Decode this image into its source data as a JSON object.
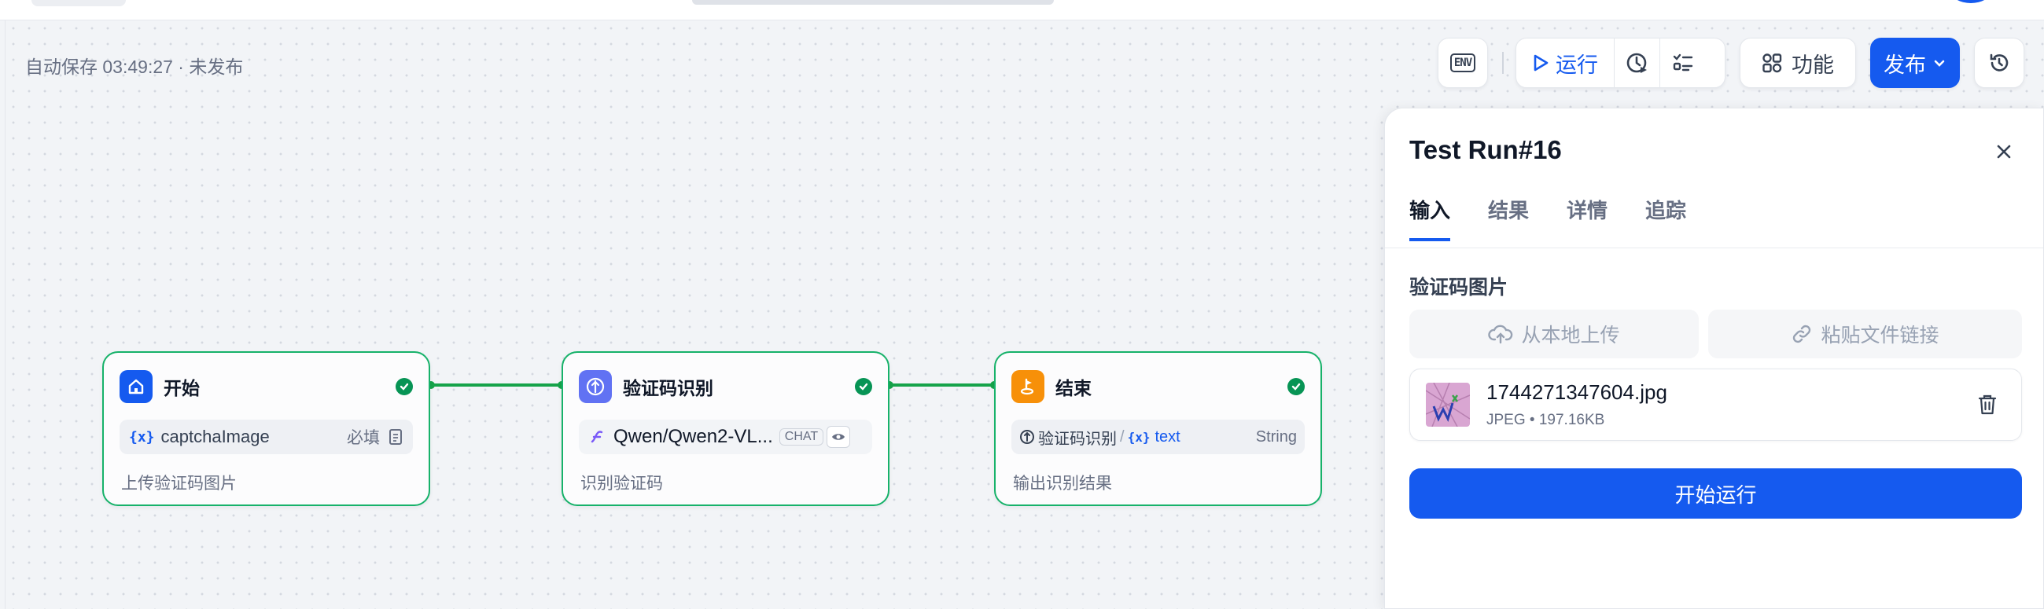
{
  "autosave": {
    "text": "自动保存 03:49:27 · 未发布"
  },
  "toolbar": {
    "env_label": "ENV",
    "run_label": "运行",
    "features_label": "功能",
    "publish_label": "发布",
    "accent": "#155aef"
  },
  "nodes": [
    {
      "title": "开始",
      "icon": "home-icon",
      "icon_color": "#155aef",
      "status": "success",
      "var_glyph": "{x}",
      "row_text": "captchaImage",
      "row_badge": "必填",
      "description": "上传验证码图片"
    },
    {
      "title": "验证码识别",
      "icon": "llm-icon",
      "icon_color": "#6172f3",
      "status": "success",
      "row_text": "Qwen/Qwen2-VL...",
      "row_tag": "CHAT",
      "description": "识别验证码"
    },
    {
      "title": "结束",
      "icon": "flag-icon",
      "icon_color": "#f79009",
      "status": "success",
      "row_source": "验证码识别",
      "var_glyph": "{x}",
      "row_var": "text",
      "row_type": "String",
      "description": "输出识别结果"
    }
  ],
  "panel": {
    "title": "Test Run#16",
    "tabs": [
      "输入",
      "结果",
      "详情",
      "追踪"
    ],
    "active_tab": "输入",
    "field_label": "验证码图片",
    "upload_local_label": "从本地上传",
    "paste_link_label": "粘贴文件链接",
    "file": {
      "name": "1744271347604.jpg",
      "type": "JPEG",
      "size": "197.16KB"
    },
    "start_button_label": "开始运行"
  },
  "colors": {
    "success": "#17b26a",
    "edge": "#16a34a",
    "primary": "#155aef"
  }
}
